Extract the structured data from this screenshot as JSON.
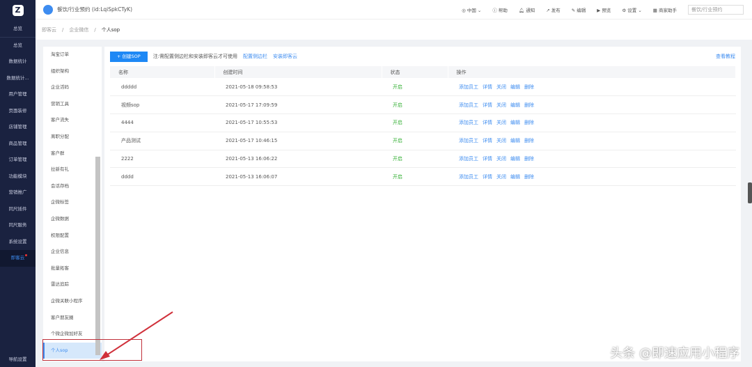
{
  "app": {
    "title": "餐饮/行业预约 (id:LqiSpkCTyK)"
  },
  "nav": {
    "top": "总览",
    "items": [
      "总览",
      "数据统计",
      "数据统计...",
      "用户管理",
      "页面装修",
      "店铺管理",
      "商品管理",
      "订单管理",
      "功能模块",
      "营销推广",
      "同尺插件",
      "同尺服务",
      "系统设置",
      "即客云"
    ],
    "bottom": "导航设置"
  },
  "toolbar": {
    "region": "中国",
    "help": "帮助",
    "notify": "通知",
    "publish": "发布",
    "edit": "编辑",
    "preview": "预览",
    "settings": "设置",
    "assistant": "商家助手",
    "select": "餐饮/行业预约"
  },
  "breadcrumb": [
    "即客云",
    "企业微信",
    "个人sop"
  ],
  "submenu": [
    "淘宝订单",
    "组织架构",
    "企业活码",
    "营销工具",
    "客户流失",
    "离职分配",
    "客户群",
    "拉新有礼",
    "会话存档",
    "企微标签",
    "企微数据",
    "权限配置",
    "企业信息",
    "批量拓客",
    "雷达追踪",
    "企微关联小程序",
    "客户朋友圈",
    "个微企微加好友",
    "个人sop"
  ],
  "main": {
    "create": "+ 创建SOP",
    "note": "注:需配置侧边栏和安装即客云才可使用",
    "link1": "配置侧边栏",
    "link2": "安装即客云",
    "help": "查看教程",
    "columns": [
      "名称",
      "创建时间",
      "状态",
      "操作"
    ],
    "rows": [
      {
        "name": "ddddd",
        "time": "2021-05-18 09:58:53",
        "status": "开启"
      },
      {
        "name": "视频sop",
        "time": "2021-05-17 17:09:59",
        "status": "开启"
      },
      {
        "name": "4444",
        "time": "2021-05-17 10:55:53",
        "status": "开启"
      },
      {
        "name": "产品测试",
        "time": "2021-05-17 10:46:15",
        "status": "开启"
      },
      {
        "name": "2222",
        "time": "2021-05-13 16:06:22",
        "status": "开启"
      },
      {
        "name": "dddd",
        "time": "2021-05-13 16:06:07",
        "status": "开启"
      }
    ],
    "ops": [
      "添加员工",
      "详情",
      "关闭",
      "编辑",
      "删除"
    ]
  },
  "watermark": "头条 @即速应用小程序"
}
